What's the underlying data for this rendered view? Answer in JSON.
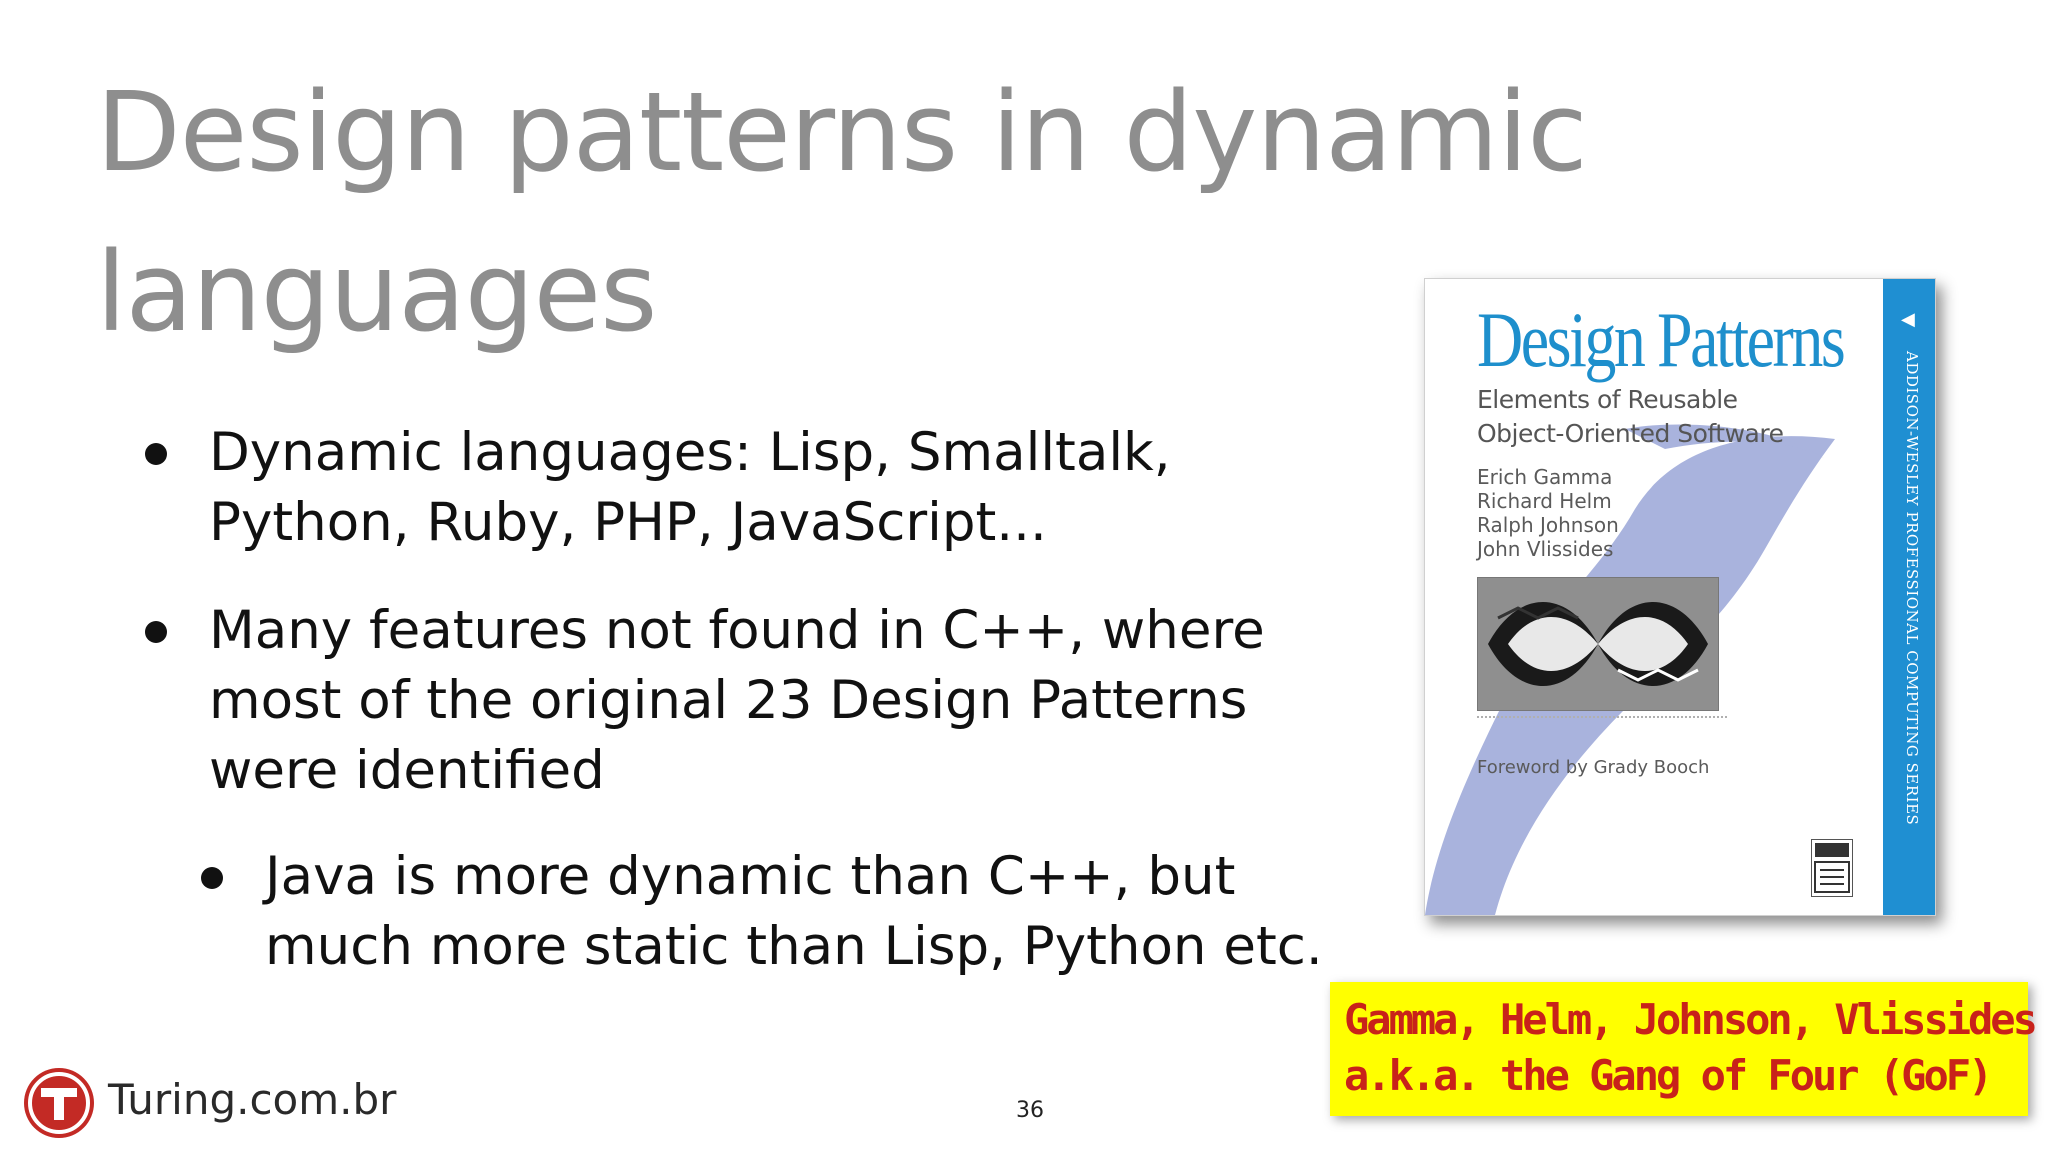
{
  "slide": {
    "title": "Design patterns in dynamic languages",
    "page_number": "36"
  },
  "bullets": [
    {
      "text": "Dynamic languages: Lisp, Smalltalk, Python, Ruby, PHP, JavaScript...",
      "level": 1
    },
    {
      "text": "Many features not found in C++, where most of the original 23 Design Patterns were identified",
      "level": 1
    },
    {
      "text": "Java is more dynamic than C++, but much more static than Lisp, Python etc.",
      "level": 2
    }
  ],
  "book_cover": {
    "title": "Design Patterns",
    "subtitle_line1": "Elements of Reusable",
    "subtitle_line2": "Object-Oriented Software",
    "authors": [
      "Erich Gamma",
      "Richard Helm",
      "Ralph Johnson",
      "John Vlissides"
    ],
    "foreword": "Foreword by Grady Booch",
    "series": "Addison-Wesley Professional Computing Series",
    "accent_color": "#1e8fcc",
    "spine_color": "#1f8fd2",
    "swoosh_color": "#a9b3dd"
  },
  "callout": {
    "line1": "Gamma, Helm, Johnson, Vlissides",
    "line2": "a.k.a. the Gang of Four (GoF)",
    "background": "#ffff00",
    "text_color": "#c8221a"
  },
  "logo": {
    "text": "Turing.com.br",
    "brand_color": "#c32a25"
  }
}
